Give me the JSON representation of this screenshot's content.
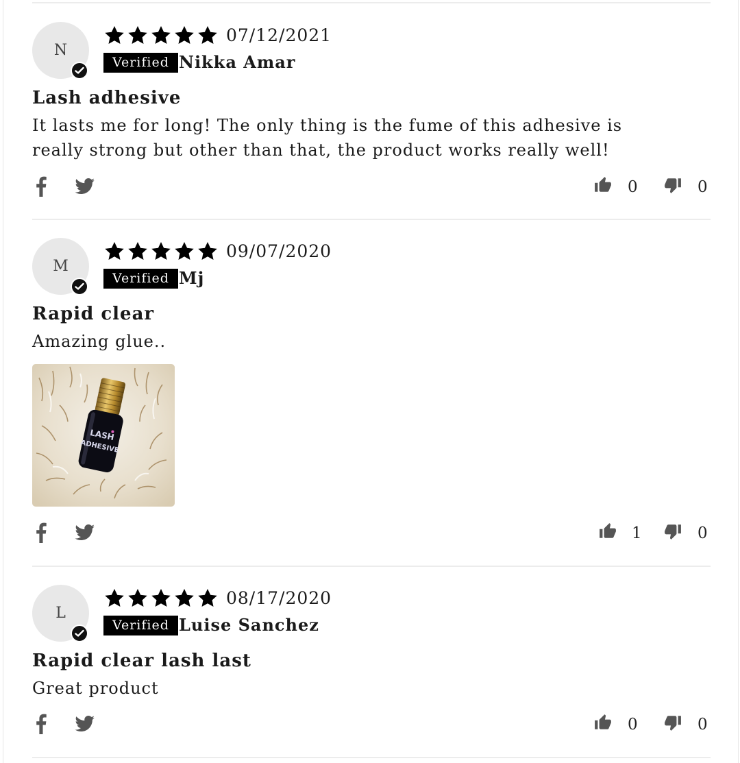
{
  "reviews": [
    {
      "initial": "N",
      "rating": 5,
      "date": "07/12/2021",
      "badge": "Verified",
      "author": "Nikka Amar",
      "title": "Lash adhesive",
      "body": "It lasts me for long! The only thing is the fume of this adhesive is really strong but other than that, the product works really well!",
      "upvotes": "0",
      "downvotes": "0"
    },
    {
      "initial": "M",
      "rating": 5,
      "date": "09/07/2020",
      "badge": "Verified",
      "author": "Mj",
      "title": "Rapid clear",
      "body": "Amazing glue..",
      "photo": {
        "bottle_label": "LASH ADHESIVE"
      },
      "upvotes": "1",
      "downvotes": "0"
    },
    {
      "initial": "L",
      "rating": 5,
      "date": "08/17/2020",
      "badge": "Verified",
      "author": "Luise Sanchez",
      "title": "Rapid clear lash last",
      "body": "Great product",
      "upvotes": "0",
      "downvotes": "0"
    }
  ],
  "colors": {
    "star": "#000000",
    "badge_bg": "#000000",
    "avatar_bg": "#e8e8e8",
    "icon": "#555555",
    "divider": "#ececec"
  },
  "icons": [
    "facebook-icon",
    "twitter-icon",
    "thumbs-up-icon",
    "thumbs-down-icon",
    "check-icon",
    "star-icon"
  ]
}
